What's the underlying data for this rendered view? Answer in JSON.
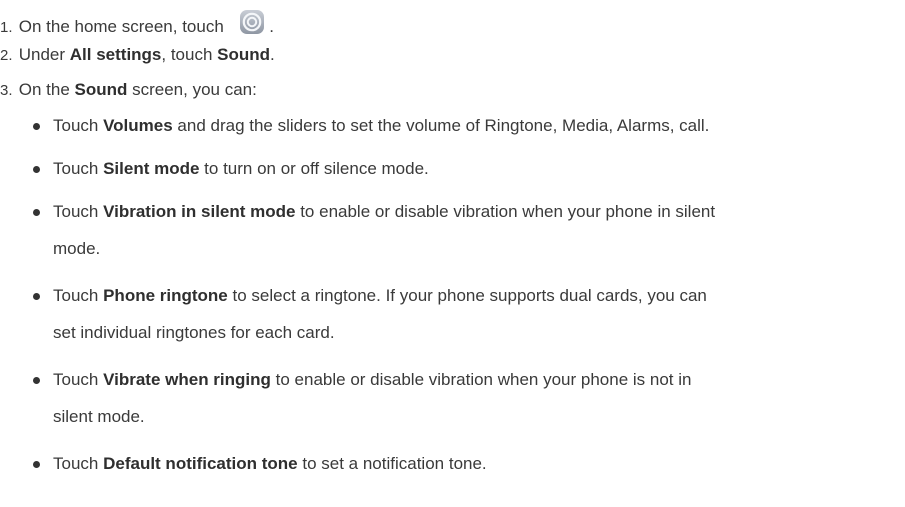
{
  "steps": [
    {
      "num": "1.",
      "text": "On the home screen, touch",
      "after_icon": ".",
      "icon": "settings-gear-icon"
    },
    {
      "num": "2.",
      "pre": "Under ",
      "bold1": "All settings",
      "mid": ", touch ",
      "bold2": "Sound",
      "post": "."
    },
    {
      "num": "3.",
      "pre": "On the ",
      "bold1": "Sound",
      "post": " screen, you can:"
    }
  ],
  "bullets": [
    {
      "pre": "Touch ",
      "bold": "Volumes",
      "post": " and drag the sliders to set the volume of Ringtone, Media, Alarms, call."
    },
    {
      "pre": "Touch ",
      "bold": "Silent mode",
      "post": " to turn on or off silence mode."
    },
    {
      "pre": "Touch ",
      "bold": "Vibration in silent mode",
      "post": " to enable or disable vibration when your phone in silent",
      "cont": "mode."
    },
    {
      "pre": "Touch ",
      "bold": "Phone ringtone",
      "post": " to select a ringtone. If your phone supports dual cards, you can",
      "cont": "set individual ringtones for each card."
    },
    {
      "pre": "Touch ",
      "bold": "Vibrate when ringing",
      "post": " to enable or disable vibration when your phone is not in",
      "cont": "silent mode."
    },
    {
      "pre": "Touch ",
      "bold": "Default notification tone",
      "post": " to set a notification tone."
    }
  ]
}
